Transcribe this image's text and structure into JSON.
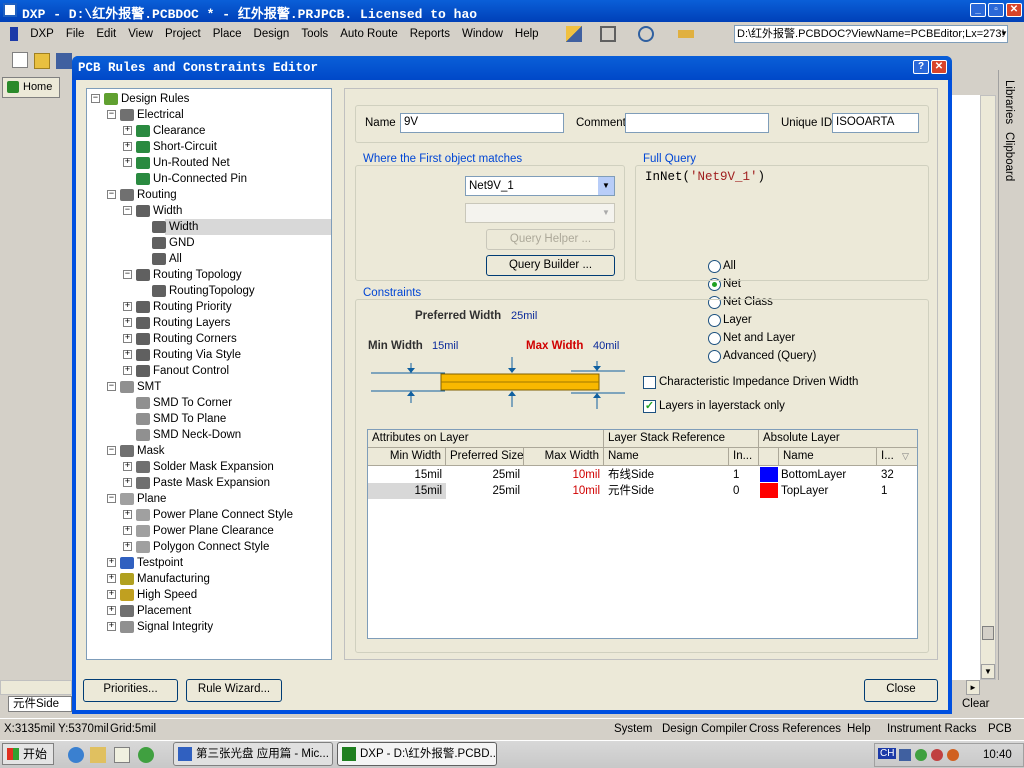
{
  "titlebar": {
    "title": "DXP - D:\\红外报警.PCBDOC * - 红外报警.PRJPCB. Licensed to hao"
  },
  "menu": [
    "DXP",
    "File",
    "Edit",
    "View",
    "Project",
    "Place",
    "Design",
    "Tools",
    "Auto Route",
    "Reports",
    "Window",
    "Help"
  ],
  "address": "D:\\红外报警.PCBDOC?ViewName=PCBEditor;Lx=273!",
  "home_tab": "Home",
  "right_panels": [
    "Libraries",
    "Clipboard"
  ],
  "dialog": {
    "title": "PCB Rules and Constraints Editor",
    "tree": [
      {
        "label": "Design Rules",
        "level": 0,
        "exp": "-",
        "icon": "design-rules-icon"
      },
      {
        "label": "Electrical",
        "level": 1,
        "exp": "-",
        "icon": "electrical-icon"
      },
      {
        "label": "Clearance",
        "level": 2,
        "exp": "+",
        "icon": "rule-icon"
      },
      {
        "label": "Short-Circuit",
        "level": 2,
        "exp": "+",
        "icon": "rule-icon"
      },
      {
        "label": "Un-Routed Net",
        "level": 2,
        "exp": "+",
        "icon": "rule-icon"
      },
      {
        "label": "Un-Connected Pin",
        "level": 2,
        "exp": "",
        "icon": "rule-icon"
      },
      {
        "label": "Routing",
        "level": 1,
        "exp": "-",
        "icon": "routing-icon"
      },
      {
        "label": "Width",
        "level": 2,
        "exp": "-",
        "icon": "width-icon"
      },
      {
        "label": "Width",
        "level": 3,
        "exp": "",
        "icon": "width-icon",
        "selected": true
      },
      {
        "label": "GND",
        "level": 3,
        "exp": "",
        "icon": "width-icon"
      },
      {
        "label": "All",
        "level": 3,
        "exp": "",
        "icon": "width-icon"
      },
      {
        "label": "Routing Topology",
        "level": 2,
        "exp": "-",
        "icon": "width-icon"
      },
      {
        "label": "RoutingTopology",
        "level": 3,
        "exp": "",
        "icon": "width-icon"
      },
      {
        "label": "Routing Priority",
        "level": 2,
        "exp": "+",
        "icon": "width-icon"
      },
      {
        "label": "Routing Layers",
        "level": 2,
        "exp": "+",
        "icon": "width-icon"
      },
      {
        "label": "Routing Corners",
        "level": 2,
        "exp": "+",
        "icon": "width-icon"
      },
      {
        "label": "Routing Via Style",
        "level": 2,
        "exp": "+",
        "icon": "width-icon"
      },
      {
        "label": "Fanout Control",
        "level": 2,
        "exp": "+",
        "icon": "width-icon"
      },
      {
        "label": "SMT",
        "level": 1,
        "exp": "-",
        "icon": "smt-icon"
      },
      {
        "label": "SMD To Corner",
        "level": 2,
        "exp": "",
        "icon": "smt-icon"
      },
      {
        "label": "SMD To Plane",
        "level": 2,
        "exp": "",
        "icon": "smt-icon"
      },
      {
        "label": "SMD Neck-Down",
        "level": 2,
        "exp": "",
        "icon": "smt-icon"
      },
      {
        "label": "Mask",
        "level": 1,
        "exp": "-",
        "icon": "mask-icon"
      },
      {
        "label": "Solder Mask Expansion",
        "level": 2,
        "exp": "+",
        "icon": "mask-icon"
      },
      {
        "label": "Paste Mask Expansion",
        "level": 2,
        "exp": "+",
        "icon": "mask-icon"
      },
      {
        "label": "Plane",
        "level": 1,
        "exp": "-",
        "icon": "plane-icon"
      },
      {
        "label": "Power Plane Connect Style",
        "level": 2,
        "exp": "+",
        "icon": "plane-icon"
      },
      {
        "label": "Power Plane Clearance",
        "level": 2,
        "exp": "+",
        "icon": "plane-icon"
      },
      {
        "label": "Polygon Connect Style",
        "level": 2,
        "exp": "+",
        "icon": "plane-icon"
      },
      {
        "label": "Testpoint",
        "level": 1,
        "exp": "+",
        "icon": "testpoint-icon"
      },
      {
        "label": "Manufacturing",
        "level": 1,
        "exp": "+",
        "icon": "manufacturing-icon"
      },
      {
        "label": "High Speed",
        "level": 1,
        "exp": "+",
        "icon": "highspeed-icon"
      },
      {
        "label": "Placement",
        "level": 1,
        "exp": "+",
        "icon": "placement-icon"
      },
      {
        "label": "Signal Integrity",
        "level": 1,
        "exp": "+",
        "icon": "signal-icon"
      }
    ],
    "name_label": "Name",
    "name_value": "9V",
    "comment_label": "Comment",
    "comment_value": "",
    "uid_label": "Unique ID",
    "uid_value": "ISOOARTA",
    "where_title": "Where the First object matches",
    "radios": [
      "All",
      "Net",
      "Net Class",
      "Layer",
      "Net and Layer",
      "Advanced (Query)"
    ],
    "radio_selected": 1,
    "net_select": "Net9V_1",
    "query_helper": "Query Helper ...",
    "query_builder": "Query Builder ...",
    "full_query_title": "Full Query",
    "full_query_prefix": "InNet(",
    "full_query_arg": "'Net9V_1'",
    "full_query_suffix": ")",
    "constraints_title": "Constraints",
    "pref_label": "Preferred Width",
    "pref_value": "25mil",
    "min_label": "Min Width",
    "min_value": "15mil",
    "max_label": "Max Width",
    "max_value": "40mil",
    "chk_impedance": "Characteristic Impedance Driven Width",
    "chk_impedance_checked": false,
    "chk_layers": "Layers in layerstack only",
    "chk_layers_checked": true,
    "table": {
      "group_headers": [
        "Attributes on Layer",
        "Layer Stack Reference",
        "Absolute Layer"
      ],
      "headers": [
        "Min Width",
        "Preferred Size",
        "Max Width",
        "Name",
        "In...",
        "Name",
        "I..."
      ],
      "rows": [
        {
          "min": "15mil",
          "pref": "25mil",
          "max": "10mil",
          "name": "布线Side",
          "idx": "1",
          "color": "#0000ff",
          "abs": "BottomLayer",
          "absidx": "32"
        },
        {
          "min": "15mil",
          "pref": "25mil",
          "max": "10mil",
          "name": "元件Side",
          "idx": "0",
          "color": "#ff0000",
          "abs": "TopLayer",
          "absidx": "1"
        }
      ]
    },
    "btn_priorities": "Priorities...",
    "btn_wizard": "Rule Wizard...",
    "btn_close": "Close"
  },
  "bottom_tab": "元件Side",
  "clear_btn": "Clear",
  "status": {
    "coords": "X:3135mil Y:5370mil",
    "grid": "Grid:5mil",
    "panels": [
      "System",
      "Design Compiler",
      "Cross References",
      "Help",
      "Instrument Racks",
      "PCB"
    ]
  },
  "taskbar": {
    "start": "开始",
    "tasks": [
      "第三张光盘 应用篇 - Mic...",
      "DXP - D:\\红外报警.PCBD..."
    ],
    "lang": "CH",
    "time": "10:40"
  }
}
